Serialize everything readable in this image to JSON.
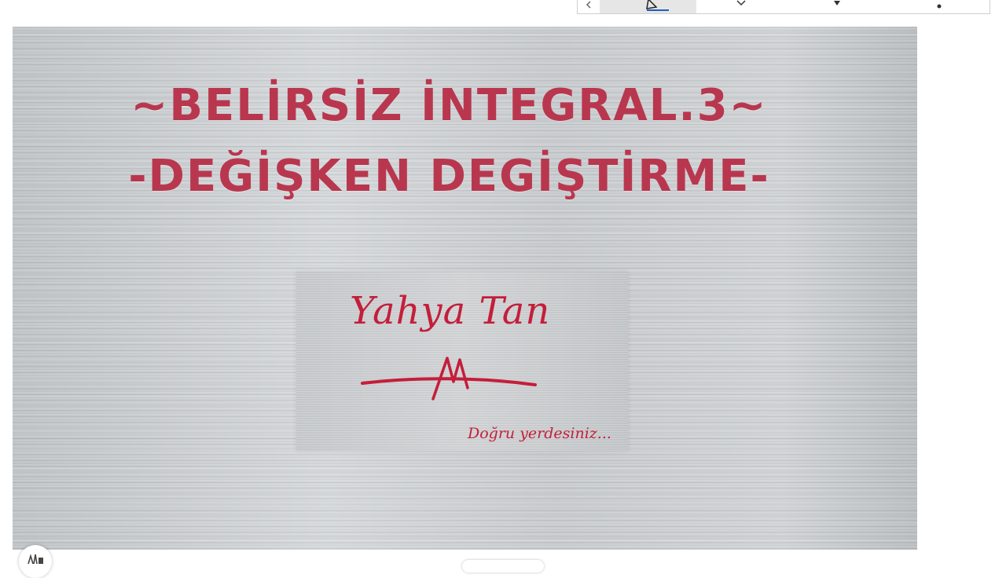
{
  "toolbar": {
    "tools": [
      {
        "name": "back-chevron-icon"
      },
      {
        "name": "pen-icon",
        "selected": true
      },
      {
        "name": "eraser-icon"
      },
      {
        "name": "highlighter-icon"
      },
      {
        "name": "dot-menu-icon"
      }
    ]
  },
  "slide": {
    "title_line_1": "~BELİRSİZ İNTEGRAL.3~",
    "title_line_2": "-DEĞİŞKEN DEGİŞTİRME-",
    "logo": {
      "signature": "Yahya Tan",
      "tagline": "Doğru yerdesiniz..."
    }
  },
  "colors": {
    "title": "#b8374f",
    "logo": "#c41e3a",
    "toolbar_selected": "#e6e6e6"
  }
}
